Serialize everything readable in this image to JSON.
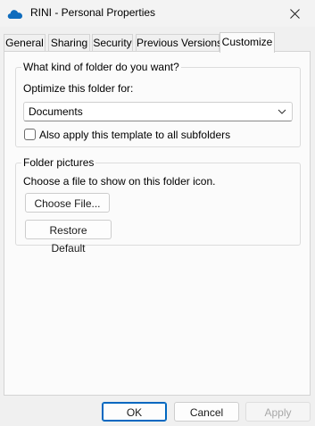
{
  "window": {
    "title": "RINI - Personal Properties",
    "app_icon": "onedrive-cloud-icon",
    "close_icon": "close-icon"
  },
  "tabs": [
    {
      "label": "General",
      "active": false
    },
    {
      "label": "Sharing",
      "active": false
    },
    {
      "label": "Security",
      "active": false
    },
    {
      "label": "Previous Versions",
      "active": false
    },
    {
      "label": "Customize",
      "active": true
    }
  ],
  "customize": {
    "folder_type": {
      "legend": "What kind of folder do you want?",
      "optimize_label": "Optimize this folder for:",
      "selected": "Documents",
      "apply_subfolders_label": "Also apply this template to all subfolders",
      "apply_subfolders_checked": false
    },
    "folder_pictures": {
      "legend": "Folder pictures",
      "description": "Choose a file to show on this folder icon.",
      "choose_file_label": "Choose File...",
      "restore_default_label": "Restore Default"
    }
  },
  "footer": {
    "ok_label": "OK",
    "cancel_label": "Cancel",
    "apply_label": "Apply"
  },
  "colors": {
    "accent": "#0067c0",
    "onedrive_blue": "#0f6cbd"
  }
}
